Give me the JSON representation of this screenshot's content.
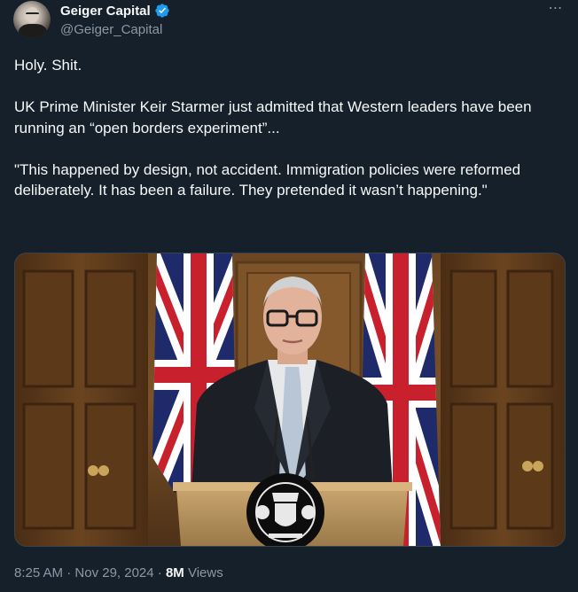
{
  "author": {
    "display_name": "Geiger Capital",
    "handle": "@Geiger_Capital",
    "verified": true,
    "verified_color": "#1d9bf0"
  },
  "more_icon": "⋯",
  "tweet": {
    "line1": "Holy. Shit.",
    "line2": "UK Prime Minister Keir Starmer just admitted that Western leaders have been running an “open borders experiment”...",
    "line3": "\"This happened by design, not accident. Immigration policies were reformed deliberately. It has been a failure. They pretended it wasn’t happening.\""
  },
  "meta": {
    "time": "8:25 AM",
    "separator1": "·",
    "date": "Nov 29, 2024",
    "separator2": "·",
    "views_count": "8M",
    "views_label": "Views"
  },
  "colors": {
    "background": "#15202b",
    "text": "#f7f9f9",
    "secondary": "#8b98a5",
    "border": "#38444d"
  }
}
